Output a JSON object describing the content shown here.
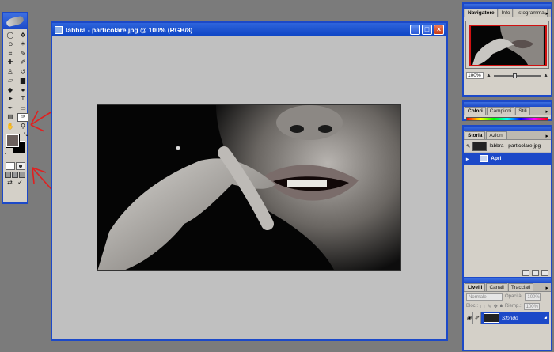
{
  "document": {
    "title": "labbra - particolare.jpg @ 100% (RGB/8)",
    "window_buttons": {
      "minimize": "_",
      "maximize": "□",
      "close": "×"
    }
  },
  "toolbox": {
    "tools": [
      {
        "icon": "marquee-icon",
        "glyph": "◯"
      },
      {
        "icon": "move-icon",
        "glyph": "✥"
      },
      {
        "icon": "lasso-icon",
        "glyph": "ഠ"
      },
      {
        "icon": "magic-wand-icon",
        "glyph": "✶"
      },
      {
        "icon": "crop-icon",
        "glyph": "⌗"
      },
      {
        "icon": "slice-icon",
        "glyph": "✎"
      },
      {
        "icon": "healing-brush-icon",
        "glyph": "✚"
      },
      {
        "icon": "brush-icon",
        "glyph": "✐"
      },
      {
        "icon": "clone-stamp-icon",
        "glyph": "♙"
      },
      {
        "icon": "history-brush-icon",
        "glyph": "↺"
      },
      {
        "icon": "eraser-icon",
        "glyph": "▱"
      },
      {
        "icon": "gradient-icon",
        "glyph": "▆"
      },
      {
        "icon": "blur-icon",
        "glyph": "◆"
      },
      {
        "icon": "dodge-icon",
        "glyph": "●"
      },
      {
        "icon": "path-select-icon",
        "glyph": "➤"
      },
      {
        "icon": "type-icon",
        "glyph": "T"
      },
      {
        "icon": "pen-icon",
        "glyph": "✒"
      },
      {
        "icon": "shape-icon",
        "glyph": "▭"
      },
      {
        "icon": "notes-icon",
        "glyph": "▤"
      },
      {
        "icon": "eyedropper-icon",
        "glyph": "✑"
      },
      {
        "icon": "hand-icon",
        "glyph": "✋"
      },
      {
        "icon": "zoom-icon",
        "glyph": "⚲"
      }
    ],
    "swatches": {
      "foreground": "#6b605d",
      "background": "#000000"
    }
  },
  "navigator": {
    "tabs": [
      "Navigatore",
      "Info",
      "Istogramma"
    ],
    "zoom": "100%"
  },
  "color": {
    "tabs": [
      "Colori",
      "Campioni",
      "Stili"
    ]
  },
  "history": {
    "tabs": [
      "Storia",
      "Azioni"
    ],
    "snapshot": "labbra - particolare.jpg",
    "step": "Apri"
  },
  "layers": {
    "tabs": [
      "Livelli",
      "Canali",
      "Tracciati"
    ],
    "blend_mode": "Normale",
    "opacity_label": "Opacità:",
    "opacity_value": "100%",
    "lock_label": "Bloc.:",
    "fill_label": "Riemp.:",
    "fill_value": "100%",
    "layer_name": "Sfondo"
  },
  "colors": {
    "accent": "#1c49c8",
    "annotation": "#e02020",
    "workspace": "#7b7b7b"
  }
}
